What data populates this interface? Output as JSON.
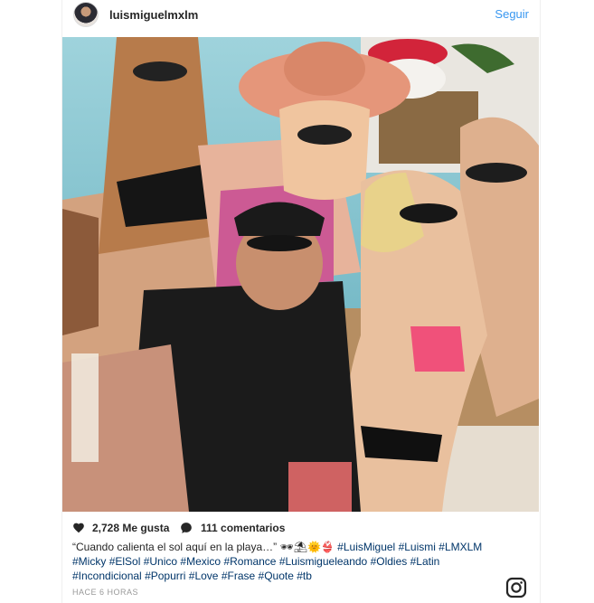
{
  "header": {
    "username": "luismiguelmxlm",
    "follow_label": "Seguir"
  },
  "post": {
    "photo_alt": "Foto de grupo en la piscina",
    "likes": "2,728 Me gusta",
    "comments": "111 comentarios",
    "caption_text": "“Cuando calienta el sol aquí en la playa…” 🕶⛱🌞👙",
    "hashtags": [
      "#LuisMiguel",
      "#Luismi",
      "#LMXLM",
      "#Micky",
      "#ElSol",
      "#Unico",
      "#Mexico",
      "#Romance",
      "#Luismigueleando",
      "#Oldies",
      "#Latin",
      "#Incondicional",
      "#Popurri",
      "#Love",
      "#Frase",
      "#Quote",
      "#tb"
    ],
    "timestamp": "HACE 6 HORAS"
  },
  "icons": {
    "like": "heart-icon",
    "comment": "comment-bubble-icon",
    "brand": "instagram-icon",
    "avatar": "avatar"
  },
  "colors": {
    "link": "#3897f0",
    "hashtag": "#003569",
    "text": "#262626",
    "muted": "#999999"
  }
}
